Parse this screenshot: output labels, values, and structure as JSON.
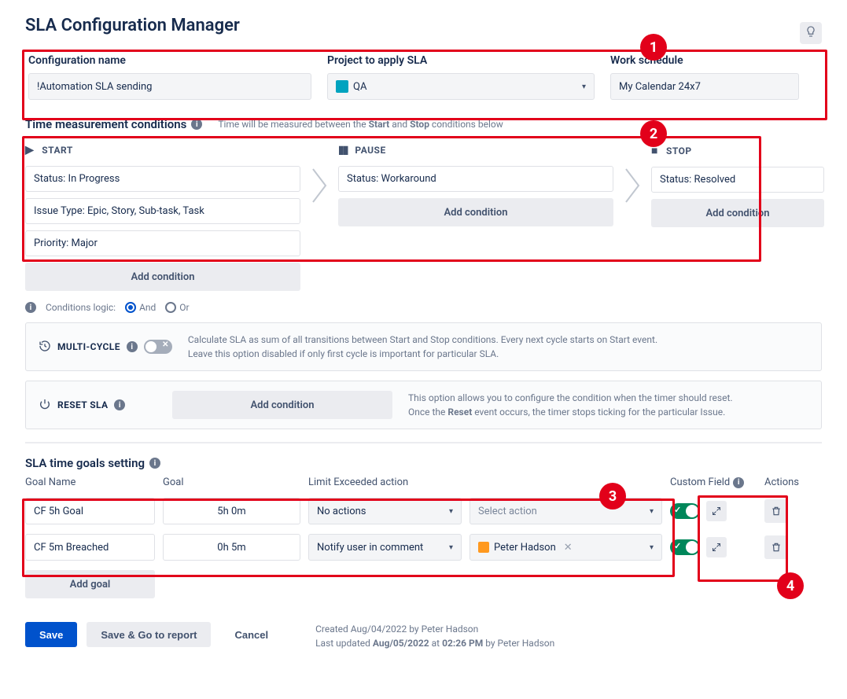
{
  "header": {
    "title": "SLA Configuration Manager"
  },
  "config": {
    "name_label": "Configuration name",
    "name_value": "!Automation  SLA sending",
    "project_label": "Project to apply SLA",
    "project_value": "QA",
    "schedule_label": "Work schedule",
    "schedule_value": "My Calendar 24x7"
  },
  "conditions": {
    "heading": "Time measurement conditions",
    "hint1": "Time will be measured between the ",
    "hint_start_bold": "Start",
    "hint_mid": " and ",
    "hint_stop_bold": "Stop",
    "hint2": " conditions below",
    "start_label": "START",
    "pause_label": "PAUSE",
    "stop_label": "STOP",
    "start_items": [
      "Status: In Progress",
      "Issue Type: Epic, Story, Sub-task, Task",
      "Priority: Major"
    ],
    "pause_items": [
      "Status: Workaround"
    ],
    "stop_items": [
      "Status: Resolved"
    ],
    "add_condition": "Add condition",
    "logic_label": "Conditions logic:",
    "logic_and": "And",
    "logic_or": "Or"
  },
  "multicycle": {
    "label": "MULTI-CYCLE",
    "desc": "Calculate SLA as sum of all transitions between Start and Stop conditions. Every next cycle starts on Start event.\nLeave this option disabled if only first cycle is important for particular SLA."
  },
  "reset": {
    "label": "RESET SLA",
    "add_condition": "Add condition",
    "desc1": "This option allows you to configure the condition when the timer should reset.",
    "desc2a": "Once the ",
    "desc2b": "Reset",
    "desc2c": " event occurs, the timer stops ticking for the particular Issue."
  },
  "goals": {
    "heading": "SLA time goals setting",
    "columns": {
      "name": "Goal Name",
      "goal": "Goal",
      "limit": "Limit Exceeded action",
      "cf": "Custom Field",
      "actions": "Actions"
    },
    "rows": [
      {
        "name": "CF 5h Goal",
        "goal": "5h 0m",
        "limit_action": "No actions",
        "action_target_placeholder": "Select action",
        "action_target": "",
        "cf_on": true
      },
      {
        "name": "CF 5m Breached",
        "goal": "0h 5m",
        "limit_action": "Notify user in comment",
        "action_target": "Peter Hadson",
        "cf_on": true
      }
    ],
    "add_goal": "Add goal"
  },
  "footer": {
    "save": "Save",
    "save_go": "Save & Go to report",
    "cancel": "Cancel",
    "created": "Created Aug/04/2022 by Peter Hadson",
    "updated1": "Last updated ",
    "updated_date": "Aug/05/2022",
    "updated2": " at ",
    "updated_time": "02:26 PM",
    "updated3": " by Peter Hadson"
  },
  "callouts": [
    "1",
    "2",
    "3",
    "4"
  ]
}
